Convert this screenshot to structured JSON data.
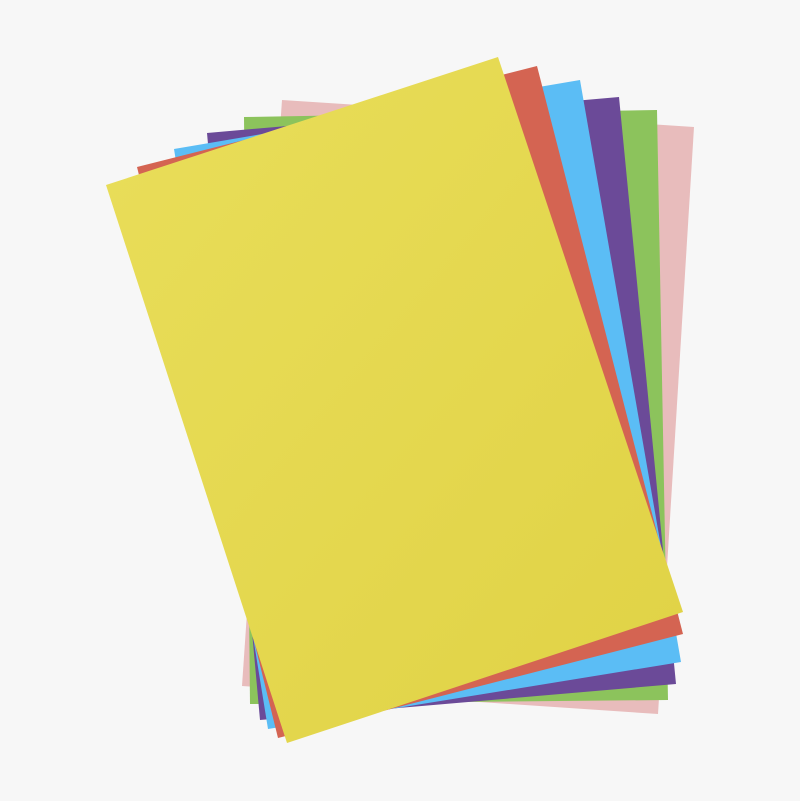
{
  "background_color": "#f7f7f7",
  "sheets": [
    {
      "name": "pink",
      "color": "#e8bcbc"
    },
    {
      "name": "green",
      "color": "#8cc35c"
    },
    {
      "name": "purple",
      "color": "#6b4a98"
    },
    {
      "name": "blue",
      "color": "#5bbdf5"
    },
    {
      "name": "red",
      "color": "#d46452"
    },
    {
      "name": "yellow",
      "color": "#e3d647"
    }
  ]
}
